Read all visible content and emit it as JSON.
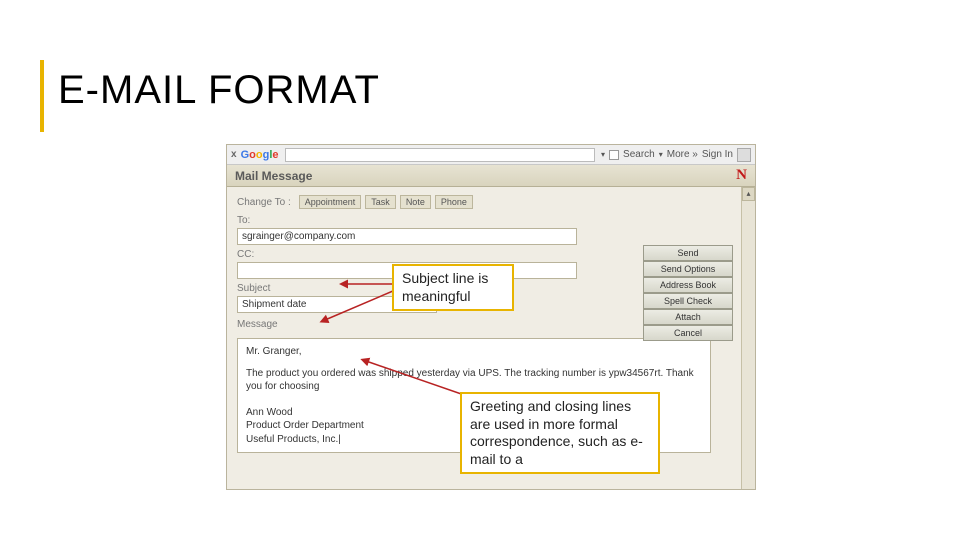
{
  "slide": {
    "title": "E-MAIL FORMAT"
  },
  "callouts": {
    "subject": "Subject line is meaningful",
    "greeting": "Greeting and closing lines are used in more formal correspondence, such as e-mail to a"
  },
  "toolbar": {
    "close": "x",
    "search_btn": "Search",
    "more_btn": "More »",
    "signin_btn": "Sign In",
    "google": {
      "g1": "G",
      "o1": "o",
      "o2": "o",
      "g2": "g",
      "l": "l",
      "e": "e"
    }
  },
  "mail": {
    "window_title": "Mail Message",
    "brand": "N",
    "change_to_label": "Change To :",
    "tabs": [
      "Appointment",
      "Task",
      "Note",
      "Phone"
    ],
    "to_label": "To:",
    "to_value": "sgrainger@company.com",
    "cc_label": "CC:",
    "cc_value": "",
    "subject_label": "Subject",
    "subject_value": "Shipment date",
    "message_label": "Message",
    "body_greeting": "Mr. Granger,",
    "body_p1": "The product you ordered was shipped yesterday via UPS.  The tracking number is ypw34567rt.  Thank you for choosing",
    "sig1": "Ann Wood",
    "sig2": "Product Order Department",
    "sig3": "Useful Products, Inc.",
    "cursor": "|"
  },
  "buttons": {
    "send": "Send",
    "send_options": "Send Options",
    "address_book": "Address Book",
    "spell_check": "Spell Check",
    "attach": "Attach",
    "cancel": "Cancel"
  }
}
